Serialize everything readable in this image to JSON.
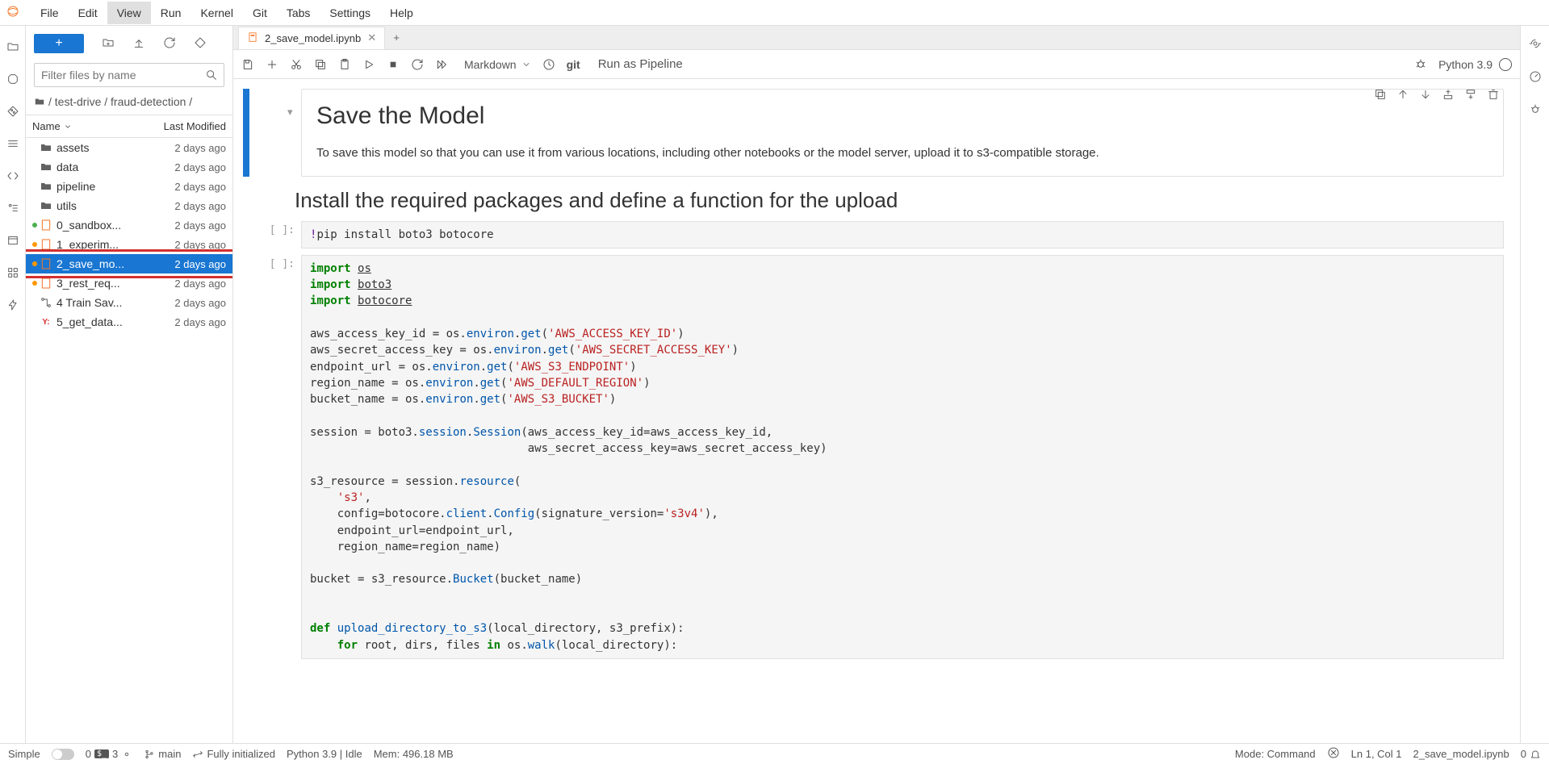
{
  "menubar": [
    "File",
    "Edit",
    "View",
    "Run",
    "Kernel",
    "Git",
    "Tabs",
    "Settings",
    "Help"
  ],
  "menubar_open": "View",
  "filepanel": {
    "filter_placeholder": "Filter files by name",
    "breadcrumb": [
      "",
      "test-drive",
      "fraud-detection",
      ""
    ],
    "columns": {
      "name": "Name",
      "modified": "Last Modified"
    },
    "items": [
      {
        "type": "folder",
        "name": "assets",
        "modified": "2 days ago"
      },
      {
        "type": "folder",
        "name": "data",
        "modified": "2 days ago"
      },
      {
        "type": "folder",
        "name": "pipeline",
        "modified": "2 days ago"
      },
      {
        "type": "folder",
        "name": "utils",
        "modified": "2 days ago"
      },
      {
        "type": "notebook",
        "name": "0_sandbox...",
        "modified": "2 days ago",
        "dot": "g"
      },
      {
        "type": "notebook",
        "name": "1_experim...",
        "modified": "2 days ago",
        "dot": "o"
      },
      {
        "type": "notebook",
        "name": "2_save_mo...",
        "modified": "2 days ago",
        "dot": "o",
        "selected": true,
        "highlight": true
      },
      {
        "type": "notebook",
        "name": "3_rest_req...",
        "modified": "2 days ago",
        "dot": "o"
      },
      {
        "type": "pipeline",
        "name": "4 Train Sav...",
        "modified": "2 days ago"
      },
      {
        "type": "yaml",
        "name": "5_get_data...",
        "modified": "2 days ago"
      }
    ]
  },
  "tabs": [
    {
      "label": "2_save_model.ipynb"
    }
  ],
  "nbtoolbar": {
    "celltype": "Markdown",
    "git_label": "git",
    "run_pipeline": "Run as Pipeline",
    "kernel": "Python 3.9"
  },
  "notebook": {
    "md1_title": "Save the Model",
    "md1_body": "To save this model so that you can use it from various locations, including other notebooks or the model server, upload it to s3-compatible storage.",
    "md2_heading": "Install the required packages and define a function for the upload",
    "code1": "!pip install boto3 botocore",
    "code2_lines": [
      "import os",
      "import boto3",
      "import botocore",
      "",
      "aws_access_key_id = os.environ.get('AWS_ACCESS_KEY_ID')",
      "aws_secret_access_key = os.environ.get('AWS_SECRET_ACCESS_KEY')",
      "endpoint_url = os.environ.get('AWS_S3_ENDPOINT')",
      "region_name = os.environ.get('AWS_DEFAULT_REGION')",
      "bucket_name = os.environ.get('AWS_S3_BUCKET')",
      "",
      "session = boto3.session.Session(aws_access_key_id=aws_access_key_id,",
      "                                aws_secret_access_key=aws_secret_access_key)",
      "",
      "s3_resource = session.resource(",
      "    's3',",
      "    config=botocore.client.Config(signature_version='s3v4'),",
      "    endpoint_url=endpoint_url,",
      "    region_name=region_name)",
      "",
      "bucket = s3_resource.Bucket(bucket_name)",
      "",
      "",
      "def upload_directory_to_s3(local_directory, s3_prefix):",
      "    for root, dirs, files in os.walk(local_directory):"
    ]
  },
  "statusbar": {
    "simple": "Simple",
    "count1": "0",
    "count2": "3",
    "branch": "main",
    "git_status": "Fully initialized",
    "kernel_info": "Python 3.9 | Idle",
    "memory": "Mem: 496.18 MB",
    "mode": "Mode: Command",
    "cursor": "Ln 1, Col 1",
    "filename": "2_save_model.ipynb",
    "notif": "0"
  }
}
